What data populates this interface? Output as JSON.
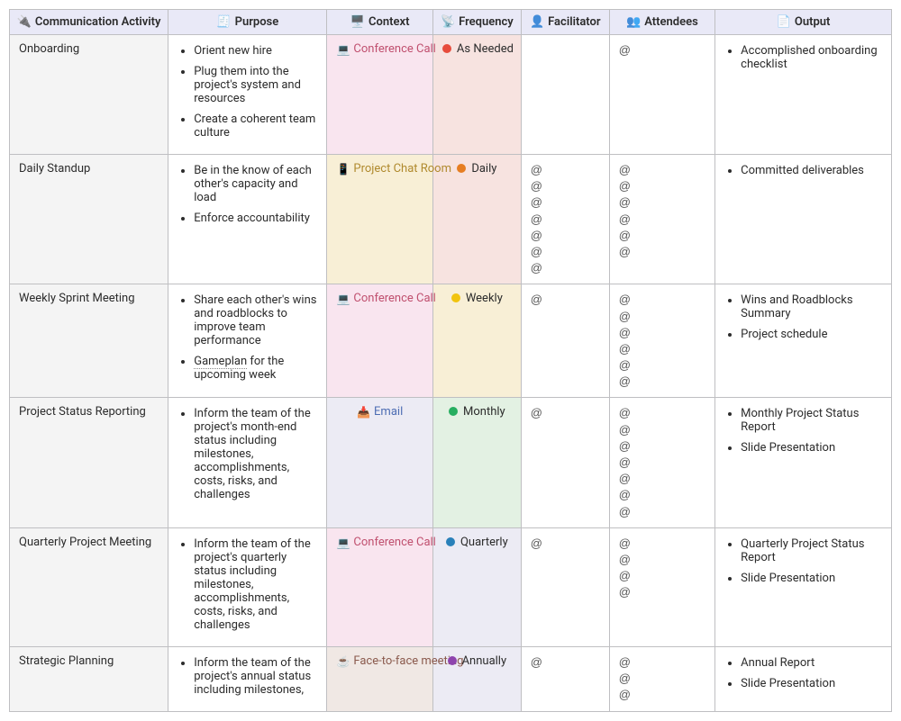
{
  "headers": {
    "activity": {
      "icon": "🔌",
      "label": "Communication Activity"
    },
    "purpose": {
      "icon": "🧾",
      "label": "Purpose"
    },
    "context": {
      "icon": "🖥️",
      "label": "Context"
    },
    "frequency": {
      "icon": "📡",
      "label": "Frequency"
    },
    "facilitator": {
      "icon": "👤",
      "label": "Facilitator"
    },
    "attendees": {
      "icon": "👥",
      "label": "Attendees"
    },
    "output": {
      "icon": "📄",
      "label": "Output"
    }
  },
  "rows": [
    {
      "activity": "Onboarding",
      "purpose": [
        "Orient new hire",
        "Plug them into the project's system and resources",
        "Create a coherent team culture"
      ],
      "context": {
        "icon": "💻",
        "label": "Conference Call",
        "bg": "ctx-pink",
        "txt": "txt-red"
      },
      "frequency": {
        "dot": "dot-red",
        "label": "As Needed",
        "bg": "freq-pink"
      },
      "facilitator_count": 0,
      "attendees_count": 1,
      "output": [
        "Accomplished onboarding checklist"
      ]
    },
    {
      "activity": "Daily Standup",
      "purpose": [
        "Be in the know of each other's capacity and load",
        "Enforce accountability"
      ],
      "context": {
        "icon": "📱",
        "label": "Project Chat Room",
        "bg": "ctx-cream",
        "txt": "txt-amber"
      },
      "frequency": {
        "dot": "dot-orange",
        "label": "Daily",
        "bg": "freq-pink"
      },
      "facilitator_count": 7,
      "attendees_count": 6,
      "output": [
        "Committed deliverables"
      ]
    },
    {
      "activity": "Weekly Sprint Meeting",
      "purpose": [
        "Share each other's wins and roadblocks to improve team performance",
        "Gameplan for the upcoming week"
      ],
      "purpose_underline_word": "Gameplan",
      "context": {
        "icon": "💻",
        "label": "Conference Call",
        "bg": "ctx-pink",
        "txt": "txt-red"
      },
      "frequency": {
        "dot": "dot-yellow",
        "label": "Weekly",
        "bg": "freq-cream"
      },
      "facilitator_count": 1,
      "attendees_count": 6,
      "output": [
        "Wins and Roadblocks Summary",
        "Project schedule"
      ]
    },
    {
      "activity": "Project Status Reporting",
      "purpose": [
        "Inform the team of the project's month-end status including milestones, accomplishments, costs, risks, and challenges"
      ],
      "context": {
        "icon": "📥",
        "label": "Email",
        "bg": "ctx-lav",
        "txt": "txt-blue"
      },
      "frequency": {
        "dot": "dot-green",
        "label": "Monthly",
        "bg": "freq-green"
      },
      "facilitator_count": 1,
      "attendees_count": 7,
      "output": [
        "Monthly Project Status Report",
        "Slide Presentation"
      ]
    },
    {
      "activity": "Quarterly Project Meeting",
      "purpose": [
        "Inform the team of the project's quarterly status including milestones, accomplishments, costs, risks, and challenges"
      ],
      "context": {
        "icon": "💻",
        "label": "Conference Call",
        "bg": "ctx-pink",
        "txt": "txt-red"
      },
      "frequency": {
        "dot": "dot-blue",
        "label": "Quarterly",
        "bg": "freq-lav"
      },
      "facilitator_count": 1,
      "attendees_count": 4,
      "output": [
        "Quarterly Project Status Report",
        "Slide Presentation"
      ]
    },
    {
      "activity": "Strategic Planning",
      "purpose": [
        "Inform the team of the project's annual status including milestones,"
      ],
      "context": {
        "icon": "☕",
        "label": "Face-to-face meeting",
        "bg": "ctx-tint",
        "txt": "txt-brown"
      },
      "frequency": {
        "dot": "dot-purple",
        "label": "Annually",
        "bg": "freq-lav"
      },
      "facilitator_count": 1,
      "attendees_count": 3,
      "output": [
        "Annual Report",
        "Slide Presentation"
      ]
    }
  ]
}
